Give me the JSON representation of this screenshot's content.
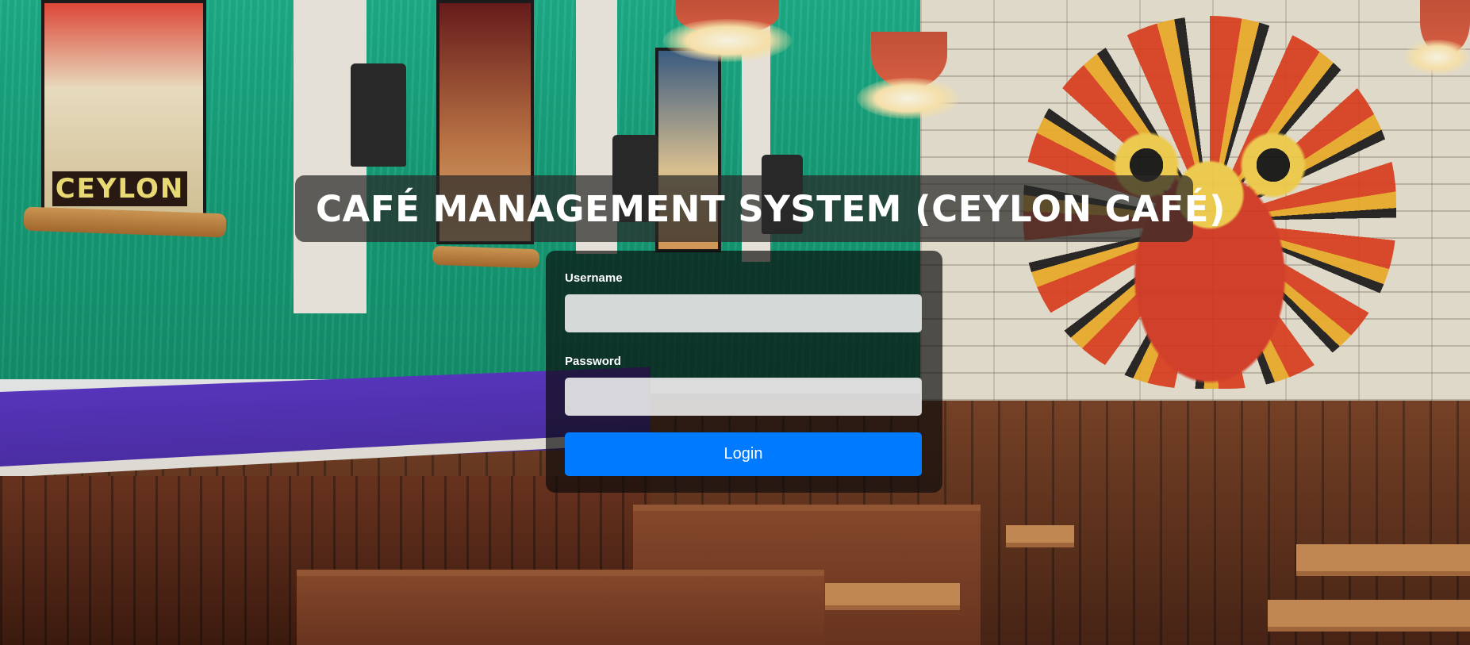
{
  "header": {
    "title": "CAFÉ MANAGEMENT SYSTEM (CEYLON CAFÉ)"
  },
  "background": {
    "poster_text": "CEYLON"
  },
  "login_form": {
    "username_label": "Username",
    "username_value": "",
    "password_label": "Password",
    "password_value": "",
    "login_label": "Login"
  },
  "colors": {
    "primary_button": "#007bff",
    "title_overlay": "rgba(40,40,40,0.72)",
    "card_overlay": "rgba(10,10,10,0.68)"
  }
}
